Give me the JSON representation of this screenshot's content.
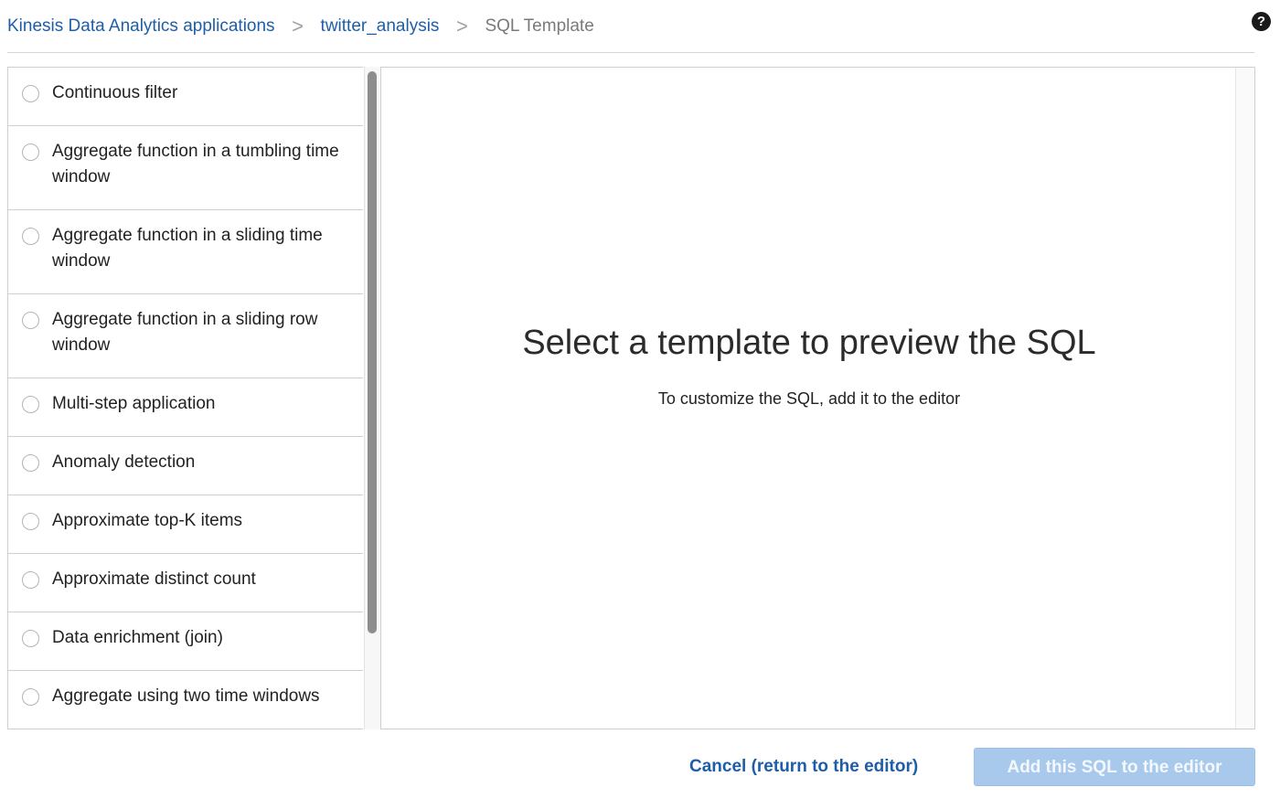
{
  "breadcrumb": {
    "items": [
      {
        "label": "Kinesis Data Analytics applications"
      },
      {
        "label": "twitter_analysis"
      },
      {
        "label": "SQL Template"
      }
    ],
    "separator": ">"
  },
  "help": {
    "icon": "help-icon",
    "glyph": "?"
  },
  "templates": [
    {
      "label": "Continuous filter",
      "selected": false
    },
    {
      "label": "Aggregate function in a tumbling time window",
      "selected": false
    },
    {
      "label": "Aggregate function in a sliding time window",
      "selected": false
    },
    {
      "label": "Aggregate function in a sliding row window",
      "selected": false
    },
    {
      "label": "Multi-step application",
      "selected": false
    },
    {
      "label": "Anomaly detection",
      "selected": false
    },
    {
      "label": "Approximate top-K items",
      "selected": false
    },
    {
      "label": "Approximate distinct count",
      "selected": false
    },
    {
      "label": "Data enrichment (join)",
      "selected": false
    },
    {
      "label": "Aggregate using two time windows",
      "selected": false
    }
  ],
  "preview": {
    "title": "Select a template to preview the SQL",
    "subtitle": "To customize the SQL, add it to the editor"
  },
  "actions": {
    "cancel_label": "Cancel (return to the editor)",
    "add_label": "Add this SQL to the editor",
    "add_disabled": true
  },
  "colors": {
    "link": "#1e5ea8",
    "disabled_button": "#a9c9ec",
    "border": "#cfcfcf"
  }
}
